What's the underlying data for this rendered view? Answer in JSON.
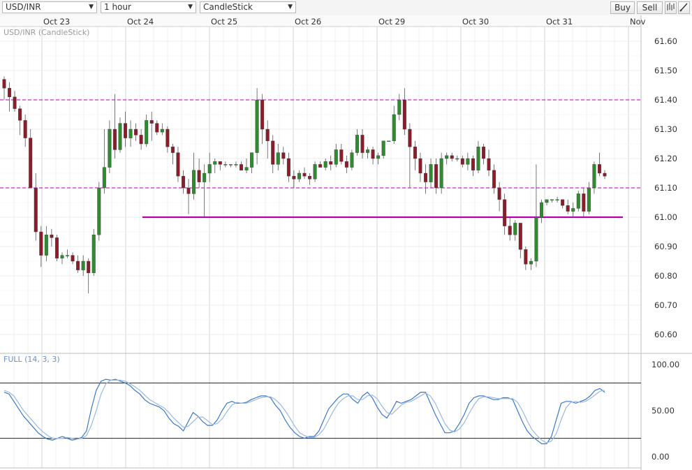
{
  "toolbar": {
    "symbol": "USD/INR",
    "interval": "1 hour",
    "chart_type": "CandleStick",
    "buy_label": "Buy",
    "sell_label": "Sell",
    "bars_icon": "bar-chart-icon",
    "draw_icon": "pencil-icon"
  },
  "colors": {
    "bull": "#2e8b2e",
    "bear": "#8b1c2a",
    "level": "#b000b0",
    "k_line": "#3a78c8",
    "d_line": "#9ab8e0",
    "grid": "#e4e4e4"
  },
  "chart_data": [
    {
      "type": "candlestick",
      "title": "USD/INR (CandleStick)",
      "x_labels": [
        "Oct 23",
        "Oct 24",
        "Oct 25",
        "Oct 26",
        "Oct 29",
        "Oct 30",
        "Oct 31",
        "Nov"
      ],
      "y_ticks": [
        "61.60",
        "61.50",
        "61.40",
        "61.30",
        "61.20",
        "61.10",
        "61.00",
        "60.90",
        "60.80",
        "60.70",
        "60.60"
      ],
      "ylim": [
        60.55,
        61.65
      ],
      "horizontal_levels": [
        {
          "value": 61.4,
          "style": "dashed"
        },
        {
          "value": 61.1,
          "style": "dashed"
        },
        {
          "value": 61.0,
          "style": "solid",
          "from": "Oct 24",
          "to": "Oct 31"
        }
      ],
      "candles_ohlc": [
        [
          61.47,
          61.48,
          61.4,
          61.44
        ],
        [
          61.44,
          61.46,
          61.36,
          61.41
        ],
        [
          61.41,
          61.43,
          61.36,
          61.37
        ],
        [
          61.37,
          61.38,
          61.28,
          61.33
        ],
        [
          61.33,
          61.35,
          61.24,
          61.27
        ],
        [
          61.27,
          61.3,
          61.1,
          61.1
        ],
        [
          61.1,
          61.15,
          60.92,
          60.95
        ],
        [
          60.95,
          60.97,
          60.83,
          60.87
        ],
        [
          60.87,
          60.97,
          60.85,
          60.94
        ],
        [
          60.94,
          60.96,
          60.9,
          60.93
        ],
        [
          60.93,
          60.94,
          60.85,
          60.86
        ],
        [
          60.86,
          60.88,
          60.84,
          60.87
        ],
        [
          60.87,
          60.89,
          60.86,
          60.87
        ],
        [
          60.87,
          60.88,
          60.84,
          60.85
        ],
        [
          60.85,
          60.87,
          60.81,
          60.82
        ],
        [
          60.82,
          60.87,
          60.8,
          60.85
        ],
        [
          60.85,
          60.86,
          60.74,
          60.81
        ],
        [
          60.81,
          60.96,
          60.8,
          60.94
        ],
        [
          60.94,
          61.12,
          60.92,
          61.1
        ],
        [
          61.1,
          61.3,
          61.08,
          61.17
        ],
        [
          61.17,
          61.33,
          61.15,
          61.3
        ],
        [
          61.3,
          61.42,
          61.2,
          61.23
        ],
        [
          61.23,
          61.34,
          61.22,
          61.32
        ],
        [
          61.32,
          61.36,
          61.24,
          61.27
        ],
        [
          61.27,
          61.33,
          61.24,
          61.3
        ],
        [
          61.3,
          61.32,
          61.26,
          61.28
        ],
        [
          61.28,
          61.3,
          61.23,
          61.25
        ],
        [
          61.25,
          61.35,
          61.24,
          61.33
        ],
        [
          61.33,
          61.36,
          61.26,
          61.32
        ],
        [
          61.32,
          61.33,
          61.28,
          61.29
        ],
        [
          61.29,
          61.32,
          61.28,
          61.3
        ],
        [
          61.3,
          61.31,
          61.22,
          61.24
        ],
        [
          61.24,
          61.25,
          61.18,
          61.22
        ],
        [
          61.22,
          61.24,
          61.12,
          61.14
        ],
        [
          61.14,
          61.16,
          61.08,
          61.1
        ],
        [
          61.1,
          61.13,
          61.01,
          61.08
        ],
        [
          61.08,
          61.22,
          61.06,
          61.16
        ],
        [
          61.16,
          61.2,
          61.1,
          61.12
        ],
        [
          61.12,
          61.18,
          61.0,
          61.15
        ],
        [
          61.15,
          61.22,
          61.12,
          61.18
        ],
        [
          61.18,
          61.2,
          61.15,
          61.19
        ],
        [
          61.19,
          61.19,
          61.16,
          61.18
        ],
        [
          61.18,
          61.19,
          61.17,
          61.18
        ],
        [
          61.18,
          61.18,
          61.17,
          61.18
        ],
        [
          61.18,
          61.19,
          61.17,
          61.18
        ],
        [
          61.18,
          61.19,
          61.16,
          61.16
        ],
        [
          61.16,
          61.2,
          61.15,
          61.17
        ],
        [
          61.17,
          61.22,
          61.15,
          61.22
        ],
        [
          61.22,
          61.44,
          61.18,
          61.4
        ],
        [
          61.4,
          61.42,
          61.25,
          61.3
        ],
        [
          61.3,
          61.33,
          61.2,
          61.26
        ],
        [
          61.26,
          61.28,
          61.15,
          61.18
        ],
        [
          61.18,
          61.25,
          61.16,
          61.22
        ],
        [
          61.22,
          61.24,
          61.18,
          61.2
        ],
        [
          61.2,
          61.22,
          61.12,
          61.14
        ],
        [
          61.14,
          61.16,
          61.1,
          61.13
        ],
        [
          61.13,
          61.16,
          61.12,
          61.15
        ],
        [
          61.15,
          61.17,
          61.13,
          61.14
        ],
        [
          61.14,
          61.15,
          61.11,
          61.13
        ],
        [
          61.13,
          61.19,
          61.12,
          61.18
        ],
        [
          61.18,
          61.19,
          61.17,
          61.17
        ],
        [
          61.17,
          61.2,
          61.16,
          61.19
        ],
        [
          61.19,
          61.21,
          61.16,
          61.18
        ],
        [
          61.18,
          61.25,
          61.17,
          61.23
        ],
        [
          61.23,
          61.25,
          61.18,
          61.19
        ],
        [
          61.19,
          61.21,
          61.15,
          61.17
        ],
        [
          61.17,
          61.23,
          61.16,
          61.22
        ],
        [
          61.22,
          61.3,
          61.21,
          61.28
        ],
        [
          61.28,
          61.3,
          61.2,
          61.22
        ],
        [
          61.22,
          61.24,
          61.2,
          61.23
        ],
        [
          61.23,
          61.24,
          61.18,
          61.2
        ],
        [
          61.2,
          61.22,
          61.18,
          61.21
        ],
        [
          61.21,
          61.26,
          61.2,
          61.26
        ],
        [
          61.26,
          61.26,
          61.26,
          61.26
        ],
        [
          61.26,
          61.38,
          61.25,
          61.35
        ],
        [
          61.35,
          61.42,
          61.33,
          61.4
        ],
        [
          61.4,
          61.44,
          61.28,
          61.3
        ],
        [
          61.3,
          61.32,
          61.1,
          61.24
        ],
        [
          61.24,
          61.26,
          61.16,
          61.2
        ],
        [
          61.2,
          61.22,
          61.12,
          61.15
        ],
        [
          61.15,
          61.18,
          61.08,
          61.12
        ],
        [
          61.12,
          61.2,
          61.1,
          61.18
        ],
        [
          61.18,
          61.2,
          61.08,
          61.1
        ],
        [
          61.1,
          61.22,
          61.08,
          61.2
        ],
        [
          61.2,
          61.22,
          61.18,
          61.21
        ],
        [
          61.21,
          61.22,
          61.19,
          61.2
        ],
        [
          61.2,
          61.21,
          61.19,
          61.2
        ],
        [
          61.2,
          61.21,
          61.17,
          61.18
        ],
        [
          61.18,
          61.22,
          61.16,
          61.2
        ],
        [
          61.2,
          61.21,
          61.14,
          61.16
        ],
        [
          61.16,
          61.26,
          61.15,
          61.24
        ],
        [
          61.24,
          61.25,
          61.18,
          61.2
        ],
        [
          61.2,
          61.23,
          61.14,
          61.16
        ],
        [
          61.16,
          61.18,
          61.08,
          61.1
        ],
        [
          61.1,
          61.12,
          61.02,
          61.06
        ],
        [
          61.06,
          61.08,
          60.94,
          60.97
        ],
        [
          60.97,
          61.0,
          60.92,
          60.94
        ],
        [
          60.94,
          60.99,
          60.92,
          60.98
        ],
        [
          60.98,
          60.98,
          60.86,
          60.89
        ],
        [
          60.89,
          60.9,
          60.82,
          60.84
        ],
        [
          60.84,
          60.86,
          60.82,
          60.85
        ],
        [
          60.85,
          61.18,
          60.83,
          61.0
        ],
        [
          61.0,
          61.06,
          60.98,
          61.05
        ],
        [
          61.05,
          61.06,
          61.04,
          61.06
        ],
        [
          61.06,
          61.06,
          61.05,
          61.06
        ],
        [
          61.06,
          61.07,
          61.05,
          61.06
        ],
        [
          61.06,
          61.06,
          61.03,
          61.04
        ],
        [
          61.04,
          61.06,
          61.01,
          61.02
        ],
        [
          61.02,
          61.05,
          61.0,
          61.03
        ],
        [
          61.03,
          61.09,
          61.02,
          61.08
        ],
        [
          61.08,
          61.1,
          61.0,
          61.02
        ],
        [
          61.02,
          61.12,
          61.01,
          61.1
        ],
        [
          61.1,
          61.19,
          61.08,
          61.18
        ],
        [
          61.18,
          61.22,
          61.14,
          61.15
        ],
        [
          61.15,
          61.16,
          61.13,
          61.14
        ]
      ]
    },
    {
      "type": "line",
      "title": "FULL (14, 3, 3)",
      "y_ticks": [
        "100.00",
        "50.00",
        "0.00"
      ],
      "ylim": [
        0,
        100
      ],
      "horizontal_levels": [
        {
          "value": 80
        },
        {
          "value": 20
        }
      ],
      "series": [
        {
          "role": "k",
          "values": [
            70,
            68,
            60,
            52,
            44,
            38,
            32,
            26,
            22,
            19,
            18,
            20,
            22,
            20,
            18,
            19,
            21,
            28,
            52,
            72,
            82,
            84,
            83,
            84,
            82,
            80,
            77,
            72,
            68,
            62,
            58,
            56,
            54,
            50,
            42,
            36,
            33,
            28,
            38,
            48,
            44,
            38,
            34,
            34,
            40,
            50,
            58,
            60,
            58,
            58,
            59,
            62,
            64,
            66,
            66,
            64,
            56,
            50,
            40,
            32,
            26,
            22,
            20,
            22,
            22,
            28,
            40,
            52,
            58,
            64,
            68,
            68,
            62,
            58,
            66,
            70,
            64,
            54,
            46,
            42,
            50,
            60,
            58,
            60,
            62,
            66,
            70,
            70,
            58,
            46,
            36,
            26,
            26,
            28,
            36,
            46,
            58,
            64,
            66,
            66,
            64,
            62,
            62,
            64,
            64,
            62,
            50,
            38,
            28,
            22,
            18,
            14,
            14,
            22,
            40,
            58,
            60,
            60,
            58,
            60,
            62,
            66,
            72,
            74,
            70
          ]
        },
        {
          "role": "d",
          "values": [
            72,
            70,
            66,
            58,
            50,
            44,
            38,
            32,
            27,
            23,
            20,
            20,
            20,
            21,
            20,
            19,
            20,
            23,
            34,
            50,
            68,
            79,
            83,
            83,
            83,
            82,
            79,
            76,
            72,
            67,
            62,
            59,
            56,
            53,
            48,
            42,
            37,
            32,
            33,
            38,
            43,
            43,
            39,
            35,
            36,
            41,
            49,
            56,
            59,
            58,
            58,
            60,
            62,
            64,
            65,
            65,
            62,
            57,
            50,
            42,
            33,
            26,
            23,
            21,
            21,
            24,
            30,
            40,
            50,
            58,
            63,
            66,
            66,
            62,
            62,
            66,
            67,
            63,
            55,
            48,
            46,
            51,
            56,
            59,
            60,
            63,
            66,
            69,
            66,
            58,
            47,
            36,
            29,
            27,
            30,
            37,
            47,
            56,
            63,
            65,
            65,
            64,
            63,
            63,
            63,
            63,
            59,
            50,
            39,
            29,
            23,
            18,
            15,
            17,
            25,
            40,
            53,
            59,
            60,
            59,
            60,
            63,
            67,
            71,
            72
          ]
        }
      ]
    }
  ]
}
